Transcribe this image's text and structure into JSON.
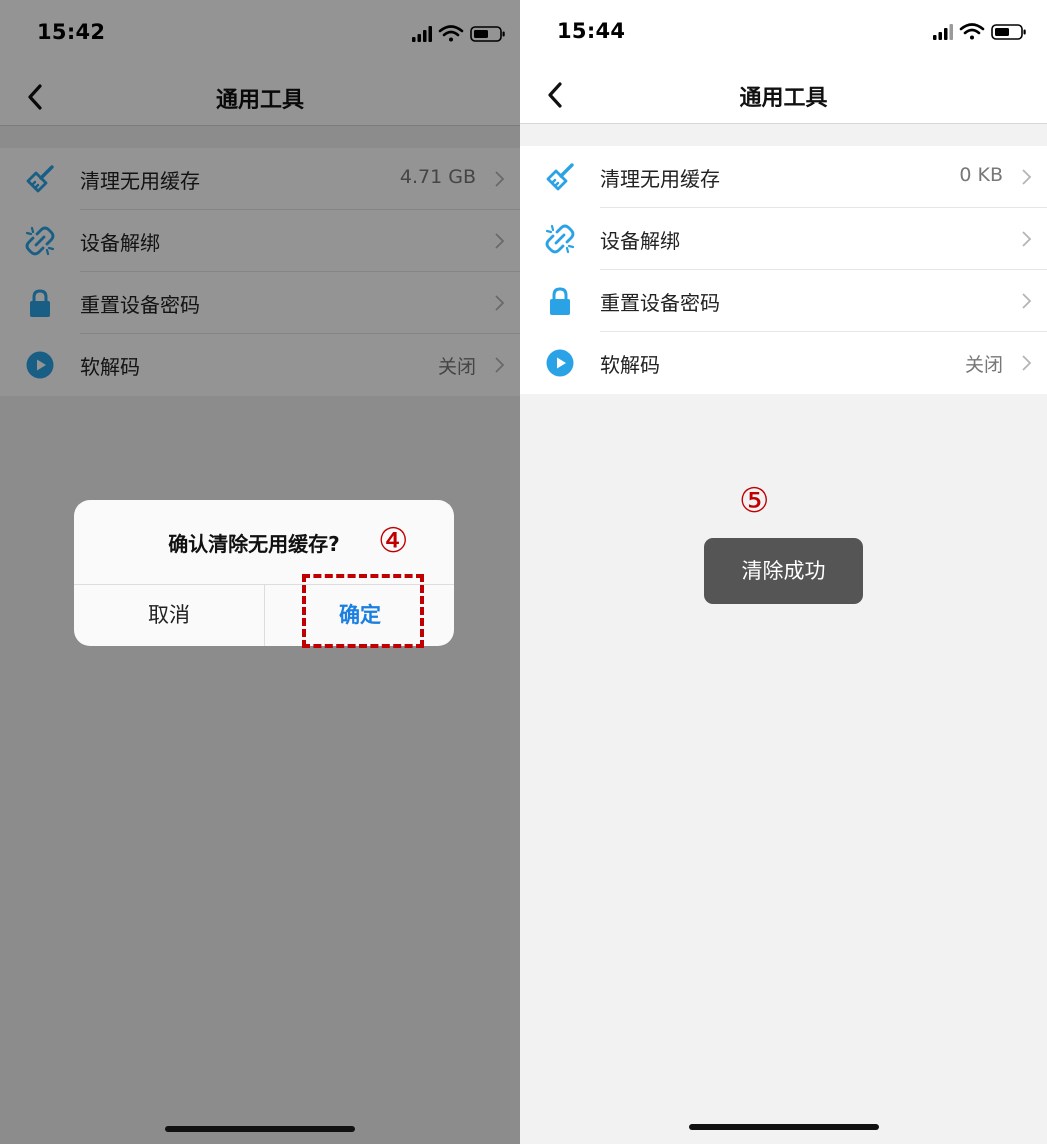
{
  "colors": {
    "accent_blue": "#2aa3e6",
    "highlight_red": "#c00000",
    "link_blue": "#1a7fe0"
  },
  "left": {
    "status": {
      "time": "15:42"
    },
    "nav": {
      "title": "通用工具"
    },
    "menu": [
      {
        "label": "清理无用缓存",
        "value": "4.71 GB",
        "icon": "broom-icon"
      },
      {
        "label": "设备解绑",
        "value": "",
        "icon": "unlink-icon"
      },
      {
        "label": "重置设备密码",
        "value": "",
        "icon": "lock-icon"
      },
      {
        "label": "软解码",
        "value": "关闭",
        "icon": "play-icon"
      }
    ],
    "dialog": {
      "title": "确认清除无用缓存?",
      "cancel": "取消",
      "confirm": "确定"
    },
    "step_marker": "④"
  },
  "right": {
    "status": {
      "time": "15:44"
    },
    "nav": {
      "title": "通用工具"
    },
    "menu": [
      {
        "label": "清理无用缓存",
        "value": "0 KB",
        "icon": "broom-icon"
      },
      {
        "label": "设备解绑",
        "value": "",
        "icon": "unlink-icon"
      },
      {
        "label": "重置设备密码",
        "value": "",
        "icon": "lock-icon"
      },
      {
        "label": "软解码",
        "value": "关闭",
        "icon": "play-icon"
      }
    ],
    "toast": "清除成功",
    "step_marker": "⑤"
  }
}
